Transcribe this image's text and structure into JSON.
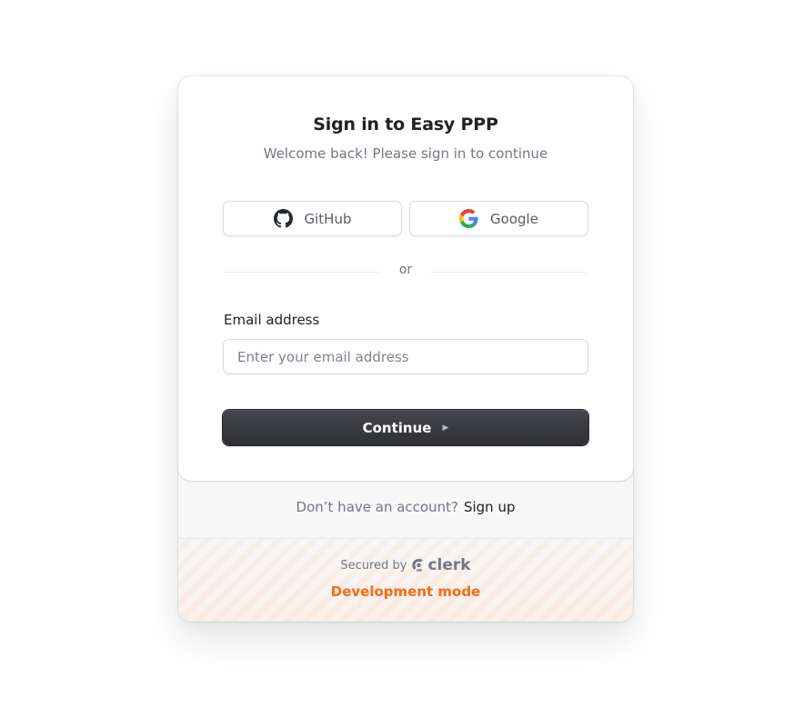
{
  "header": {
    "title": "Sign in to Easy PPP",
    "subtitle": "Welcome back! Please sign in to continue"
  },
  "social": {
    "github_label": "GitHub",
    "github_icon": "github-icon",
    "google_label": "Google",
    "google_icon": "google-icon"
  },
  "divider": {
    "text": "or"
  },
  "form": {
    "email_label": "Email address",
    "email_placeholder": "Enter your email address",
    "email_value": "",
    "continue_label": "Continue",
    "continue_icon": "triangle-right-icon"
  },
  "signup": {
    "prompt": "Don’t have an account?",
    "link_label": "Sign up"
  },
  "footer": {
    "secured_by": "Secured by",
    "brand": "clerk",
    "mode": "Development mode"
  },
  "colors": {
    "primary_button": "#2f3035",
    "dev_mode_accent": "#f36b16",
    "muted_text": "#747686"
  }
}
